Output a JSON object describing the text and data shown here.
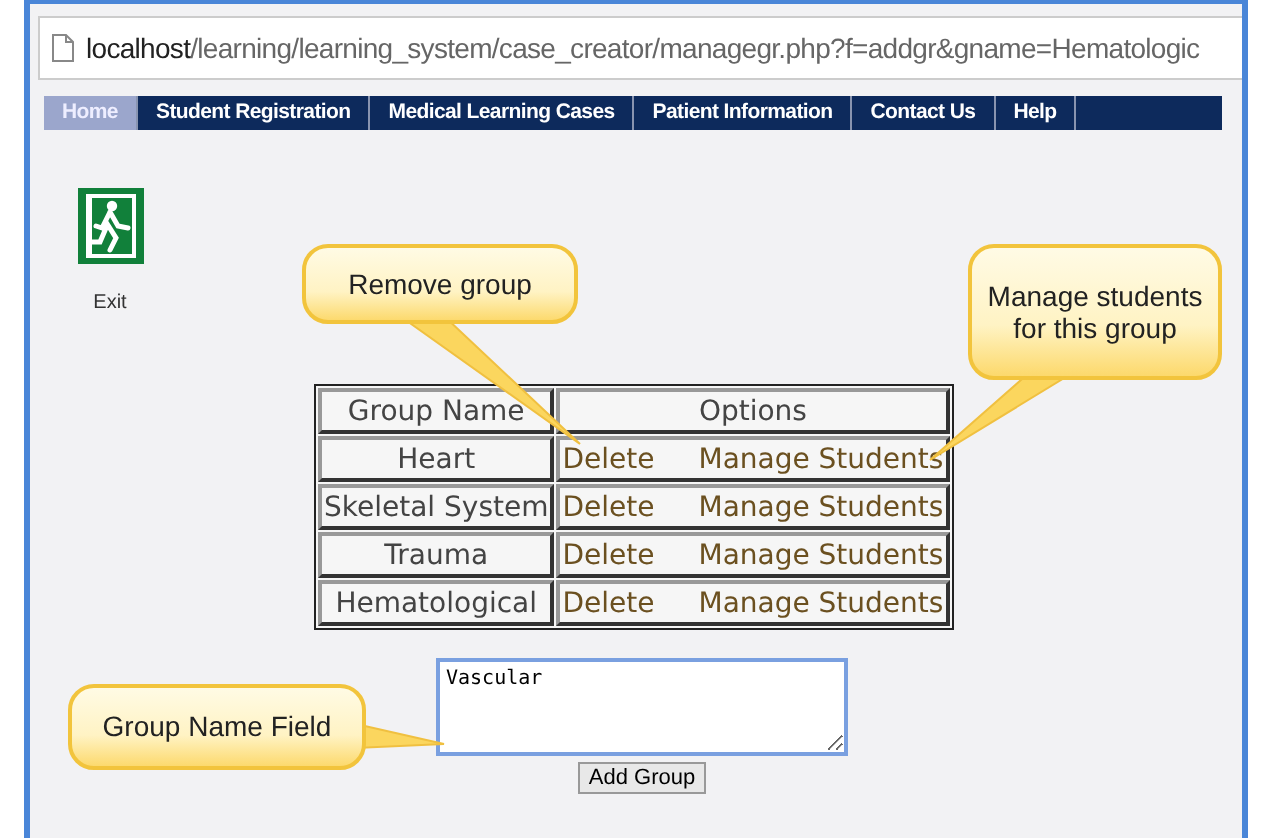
{
  "address_bar": {
    "host": "localhost",
    "path": "/learning/learning_system/case_creator/managegr.php?f=addgr&gname=Hematologic"
  },
  "nav": {
    "items": [
      {
        "label": "Home",
        "selected": true
      },
      {
        "label": "Student Registration",
        "selected": false
      },
      {
        "label": "Medical Learning Cases",
        "selected": false
      },
      {
        "label": "Patient Information",
        "selected": false
      },
      {
        "label": "Contact Us",
        "selected": false
      },
      {
        "label": "Help",
        "selected": false
      }
    ]
  },
  "exit": {
    "label": "Exit"
  },
  "table": {
    "columns": [
      "Group Name",
      "Options"
    ],
    "rows": [
      {
        "group_name": "Heart",
        "actions": [
          "Delete",
          "Manage Students"
        ]
      },
      {
        "group_name": "Skeletal System",
        "actions": [
          "Delete",
          "Manage Students"
        ]
      },
      {
        "group_name": "Trauma",
        "actions": [
          "Delete",
          "Manage Students"
        ]
      },
      {
        "group_name": "Hematological",
        "actions": [
          "Delete",
          "Manage Students"
        ]
      }
    ]
  },
  "form": {
    "value": "Vascular",
    "button": "Add Group"
  },
  "callouts": [
    {
      "text": "Remove group"
    },
    {
      "text": "Manage students for this group"
    },
    {
      "text": "Group Name Field"
    }
  ]
}
